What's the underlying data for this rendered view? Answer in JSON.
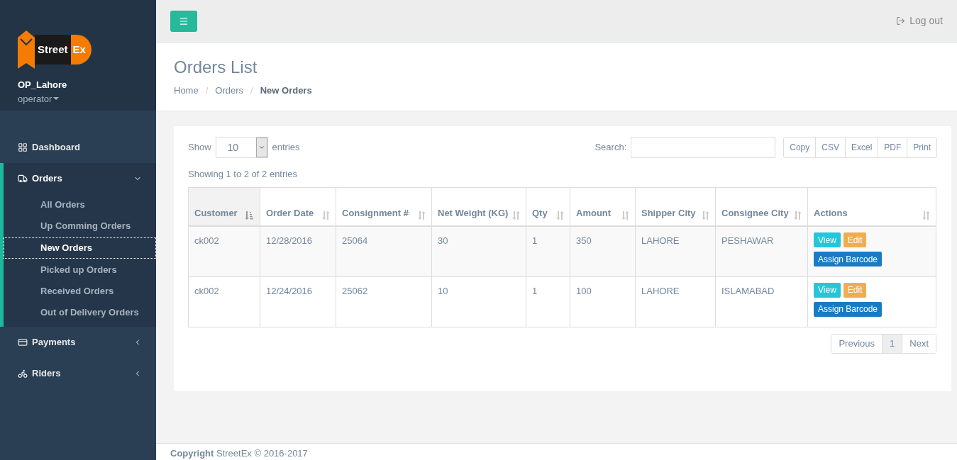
{
  "sidebar": {
    "logo": {
      "word_1": "Street",
      "word_2": "Ex"
    },
    "user": {
      "name": "OP_Lahore",
      "role": "operator"
    },
    "items": [
      {
        "label": "Dashboard",
        "kind": "grid",
        "expanded": false,
        "has_children": false
      },
      {
        "label": "Orders",
        "kind": "truck",
        "expanded": true,
        "has_children": true,
        "children": [
          {
            "label": "All Orders",
            "selected": false
          },
          {
            "label": "Up Comming Orders",
            "selected": false
          },
          {
            "label": "New Orders",
            "selected": true
          },
          {
            "label": "Picked up Orders",
            "selected": false
          },
          {
            "label": "Received Orders",
            "selected": false
          },
          {
            "label": "Out of Delivery Orders",
            "selected": false
          }
        ]
      },
      {
        "label": "Payments",
        "kind": "card",
        "expanded": false,
        "has_children": true
      },
      {
        "label": "Riders",
        "kind": "bike",
        "expanded": false,
        "has_children": true
      }
    ]
  },
  "topbar": {
    "logout": "Log out"
  },
  "page": {
    "title": "Orders List",
    "breadcrumb": [
      {
        "label": "Home"
      },
      {
        "separator": "/",
        "label": "Orders"
      },
      {
        "separator": "/",
        "label": "New Orders"
      }
    ]
  },
  "table_controls": {
    "show_label": "Show",
    "page_size": "10",
    "entries_label": "entries",
    "search_label": "Search:",
    "export_buttons": [
      "Copy",
      "CSV",
      "Excel",
      "PDF",
      "Print"
    ],
    "info": "Showing 1 to 2 of 2 entries"
  },
  "table": {
    "columns": [
      {
        "label": "Customer",
        "sorted": true
      },
      {
        "label": "Order Date",
        "sorted": false
      },
      {
        "label": "Consignment #",
        "sorted": false
      },
      {
        "label": "Net Weight (KG)",
        "sorted": false
      },
      {
        "label": "Qty",
        "sorted": false
      },
      {
        "label": "Amount",
        "sorted": false
      },
      {
        "label": "Shipper City",
        "sorted": false
      },
      {
        "label": "Consignee City",
        "sorted": false
      },
      {
        "label": "Actions",
        "sorted": false
      }
    ],
    "rows": [
      {
        "cells": [
          "ck002",
          "12/28/2016",
          "25064",
          "30",
          "1",
          "350",
          "LAHORE",
          "PESHAWAR"
        ],
        "actions": [
          "View",
          "Edit",
          "Assign Barcode"
        ]
      },
      {
        "cells": [
          "ck002",
          "12/24/2016",
          "25062",
          "10",
          "1",
          "100",
          "LAHORE",
          "ISLAMABAD"
        ],
        "actions": [
          "View",
          "Edit",
          "Assign Barcode"
        ]
      }
    ]
  },
  "pagination": [
    {
      "label": "Previous",
      "selected": false
    },
    {
      "label": "1",
      "selected": true
    },
    {
      "label": "Next",
      "selected": false
    }
  ],
  "footer": "**Copyright** StreetEx © 2016-2017"
}
